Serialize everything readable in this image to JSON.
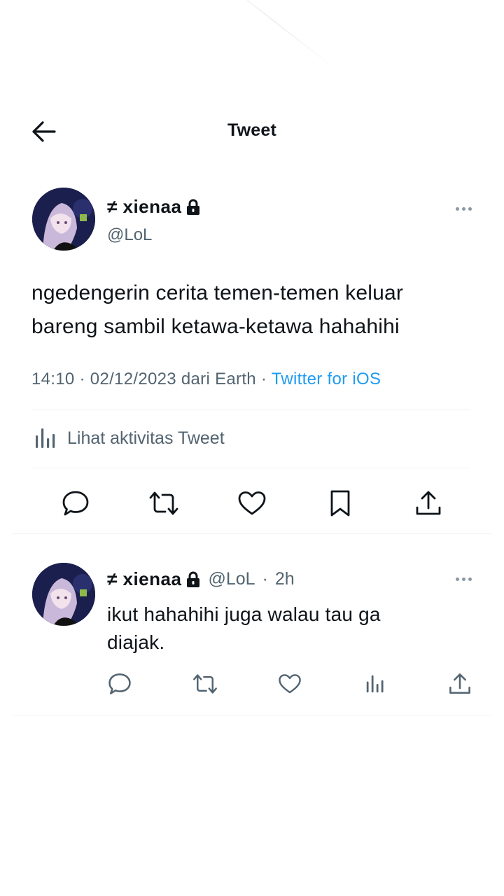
{
  "header": {
    "title": "Tweet"
  },
  "main_tweet": {
    "display_name": "≠ xienaa",
    "handle": "@LoL",
    "text_line1": "ngedengerin cerita temen-temen keluar",
    "text_line2": "bareng sambil ketawa-ketawa hahahihi",
    "time": "14:10",
    "date": "02/12/2023",
    "location": "dari Earth",
    "separator": "·",
    "source": "Twitter for iOS",
    "activity_label": "Lihat aktivitas Tweet",
    "source_color": "#1d9bf0"
  },
  "reply": {
    "display_name": "≠ xienaa",
    "handle": "@LoL",
    "separator": "·",
    "time_ago": "2h",
    "text_line1": "ikut hahahihi juga walau tau ga",
    "text_line2": "diajak."
  },
  "icons": {
    "back": "arrow-left-icon",
    "lock": "lock-icon",
    "more": "more-horizontal-icon",
    "reply": "comment-icon",
    "retweet": "retweet-icon",
    "like": "heart-icon",
    "bookmark": "bookmark-icon",
    "share": "share-icon",
    "analytics": "analytics-icon"
  },
  "colors": {
    "text_primary": "#0f1419",
    "text_secondary": "#536471",
    "accent": "#1d9bf0"
  }
}
